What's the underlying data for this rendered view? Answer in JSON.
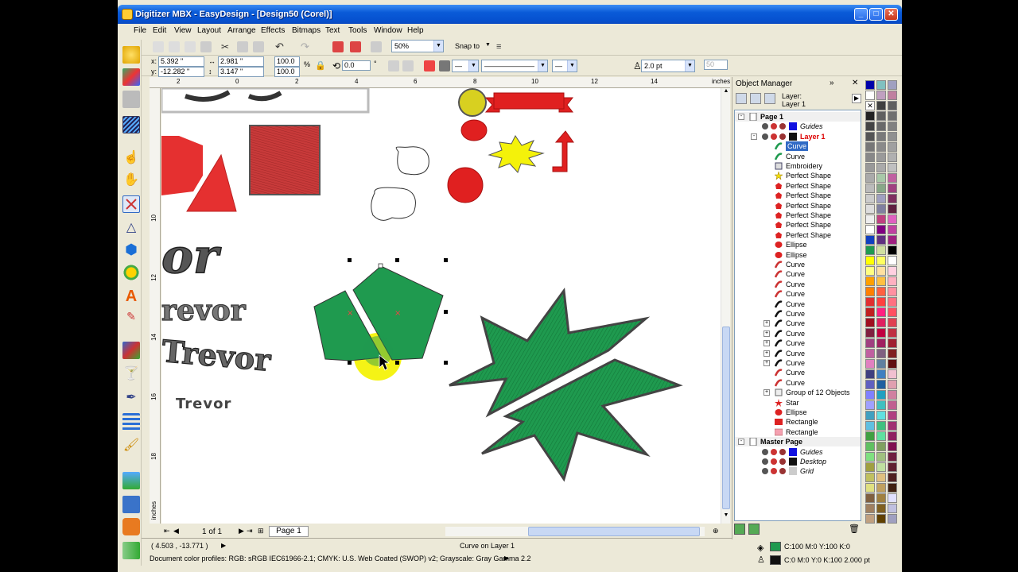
{
  "window": {
    "title": "Digitizer MBX - EasyDesign - [Design50 (Corel)]"
  },
  "menu": [
    "File",
    "Edit",
    "View",
    "Layout",
    "Arrange",
    "Effects",
    "Bitmaps",
    "Text",
    "Tools",
    "Window",
    "Help"
  ],
  "toolbar": {
    "zoom": "50%",
    "snap_to": "Snap to"
  },
  "property_bar": {
    "x": "5.392 \"",
    "y": "-12.282 \"",
    "width": "2.981 \"",
    "height": "3.147 \"",
    "scale_x": "100.0",
    "scale_y": "100.0",
    "rotation": "0.0",
    "rotation_unit": "°",
    "outline_width": "2.0 pt",
    "dash_value": "50"
  },
  "ruler": {
    "unit": "inches",
    "top_ticks": [
      "2",
      "0",
      "2",
      "4",
      "6",
      "8",
      "10",
      "12",
      "14"
    ],
    "left_ticks": [
      "10",
      "12",
      "14",
      "16",
      "18"
    ],
    "left_unit": "inches"
  },
  "canvas": {
    "text_or": "or",
    "text_trevor1": "revor",
    "text_trevor2": "Trevor",
    "text_trevor3": "Trevor"
  },
  "page_nav": {
    "count": "1 of 1",
    "tab": "Page 1"
  },
  "status": {
    "coords": "( 4.503 , -13.771 )",
    "selection": "Curve on Layer 1",
    "profiles": "Document color profiles: RGB: sRGB IEC61966-2.1; CMYK: U.S. Web Coated (SWOP) v2; Grayscale: Gray Gamma 2.2",
    "fill": "C:100 M:0 Y:100 K:0",
    "outline": "C:0 M:0 Y:0 K:100  2.000 pt"
  },
  "object_manager": {
    "title": "Object Manager",
    "layer_label": "Layer:",
    "layer_name": "Layer 1",
    "page1": "Page 1",
    "guides": "Guides",
    "layer1": "Layer 1",
    "items": [
      "Curve",
      "Curve",
      "Embroidery",
      "Perfect Shape",
      "Perfect Shape",
      "Perfect Shape",
      "Perfect Shape",
      "Perfect Shape",
      "Perfect Shape",
      "Perfect Shape",
      "Ellipse",
      "Ellipse",
      "Curve",
      "Curve",
      "Curve",
      "Curve",
      "Curve",
      "Curve",
      "Curve",
      "Curve",
      "Curve",
      "Curve",
      "Curve",
      "Curve",
      "Curve",
      "Group of 12 Objects",
      "Star",
      "Ellipse",
      "Rectangle",
      "Rectangle"
    ],
    "master_page": "Master Page",
    "master_items": [
      "Guides",
      "Desktop",
      "Grid"
    ]
  },
  "colors": {
    "green": "#1f9a4f",
    "red": "#e53030",
    "yellow": "#f4f20a",
    "selection_bg": "#316ac5"
  }
}
